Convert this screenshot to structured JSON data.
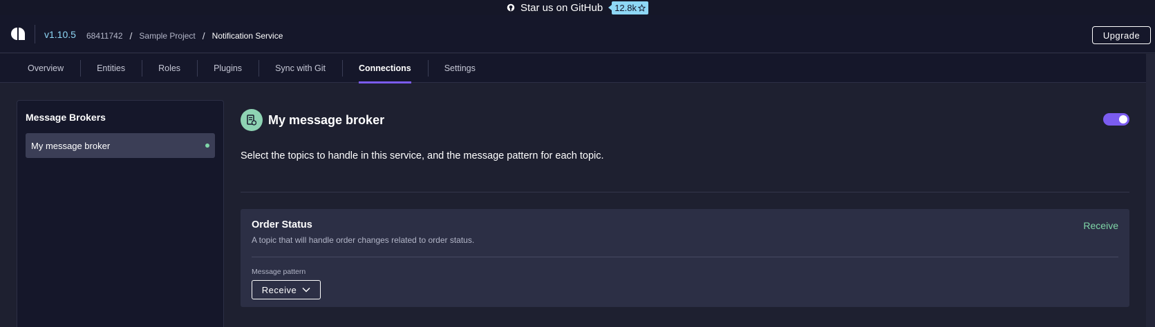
{
  "banner": {
    "text": "Star us on GitHub",
    "stars": "12.8k",
    "icons": [
      "github-icon",
      "star-icon"
    ]
  },
  "header": {
    "version": "v1.10.5",
    "breadcrumb": [
      "68411742",
      "Sample Project",
      "Notification Service"
    ],
    "separator": "/",
    "upgrade_label": "Upgrade"
  },
  "tabs": [
    {
      "label": "Overview",
      "active": false
    },
    {
      "label": "Entities",
      "active": false
    },
    {
      "label": "Roles",
      "active": false
    },
    {
      "label": "Plugins",
      "active": false
    },
    {
      "label": "Sync with Git",
      "active": false
    },
    {
      "label": "Connections",
      "active": true
    },
    {
      "label": "Settings",
      "active": false
    }
  ],
  "sidebar": {
    "title": "Message Brokers",
    "items": [
      {
        "label": "My message broker",
        "selected": true,
        "status": "active"
      }
    ]
  },
  "main": {
    "title": "My message broker",
    "enabled": true,
    "description": "Select the topics to handle in this service, and the message pattern for each topic.",
    "topics": [
      {
        "name": "Order Status",
        "description": "A topic that will handle order changes related to order status.",
        "status": "Receive",
        "pattern_label": "Message pattern",
        "pattern_value": "Receive"
      }
    ]
  },
  "colors": {
    "accent": "#7b5cf0",
    "success": "#7fd6a8",
    "link": "#8ed7f5",
    "background": "#1e2030",
    "panel": "#15172a"
  }
}
